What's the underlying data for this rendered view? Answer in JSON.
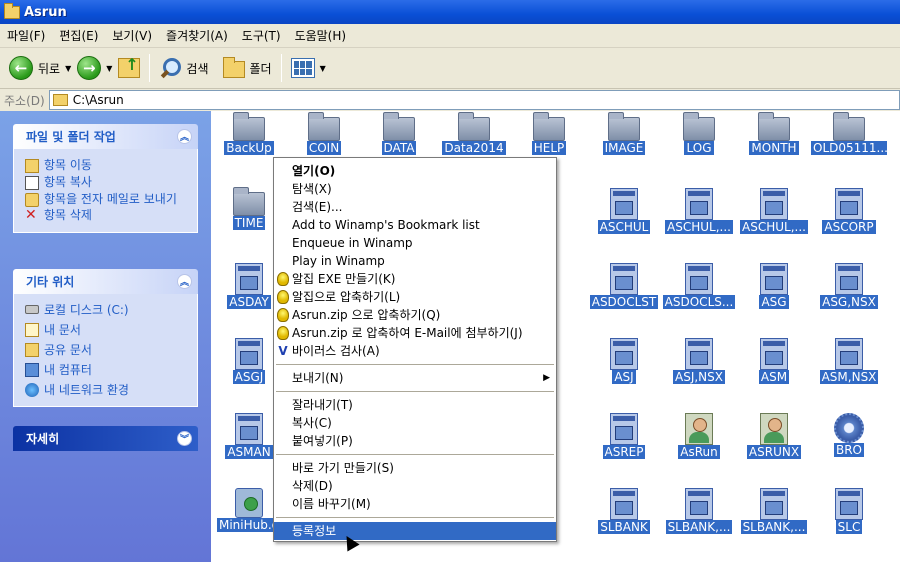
{
  "window": {
    "title": "Asrun"
  },
  "menubar": [
    "파일(F)",
    "편집(E)",
    "보기(V)",
    "즐겨찾기(A)",
    "도구(T)",
    "도움말(H)"
  ],
  "toolbar": {
    "back": "뒤로",
    "search": "검색",
    "folders": "폴더"
  },
  "address": {
    "label": "주소(D)",
    "path": "C:\\Asrun"
  },
  "taskpane": {
    "file_tasks": {
      "title": "파일 및 폴더 작업",
      "items": [
        "항목 이동",
        "항목 복사",
        "항목을 전자 메일로 보내기",
        "항목 삭제"
      ]
    },
    "other_places": {
      "title": "기타 위치",
      "items": [
        "로컬 디스크 (C:)",
        "내 문서",
        "공유 문서",
        "내 컴퓨터",
        "내 네트워크 환경"
      ]
    },
    "details": {
      "title": "자세히"
    }
  },
  "files": {
    "row1": [
      "BackUp",
      "COIN",
      "DATA",
      "Data2014",
      "HELP",
      "IMAGE",
      "LOG",
      "MONTH",
      "OLD05111..."
    ],
    "row2": [
      "TIME",
      "ASCHUL",
      "ASCHUL,...",
      "ASCHUL,...",
      "ASCORP"
    ],
    "row3": [
      "ASDAY",
      "ASDOCLST",
      "ASDOCLS...",
      "ASG",
      "ASG,NSX"
    ],
    "row4": [
      "ASGJ",
      "ASJ",
      "ASJ,NSX",
      "ASM",
      "ASM,NSX"
    ],
    "row5": [
      "ASMAN",
      "ASREP",
      "AsRun",
      "ASRUNX",
      "BRO"
    ],
    "row6": [
      "MiniHub.o",
      "SLBANK",
      "SLBANK,...",
      "SLBANK,...",
      "SLC"
    ]
  },
  "context_menu": [
    {
      "label": "열기(O)",
      "bold": true
    },
    {
      "label": "탐색(X)"
    },
    {
      "label": "검색(E)..."
    },
    {
      "label": "Add to Winamp's Bookmark list"
    },
    {
      "label": "Enqueue in Winamp"
    },
    {
      "label": "Play in Winamp"
    },
    {
      "label": "알집 EXE 만들기(K)",
      "icon": "bulb"
    },
    {
      "label": "알집으로 압축하기(L)",
      "icon": "bulb"
    },
    {
      "label": "Asrun.zip 으로 압축하기(Q)",
      "icon": "bulb"
    },
    {
      "label": "Asrun.zip 로 압축하여 E-Mail에 첨부하기(J)",
      "icon": "bulb"
    },
    {
      "label": "바이러스 검사(A)",
      "icon": "virus"
    },
    {
      "label": "보내기(N)",
      "submenu": true
    },
    {
      "label": "잘라내기(T)"
    },
    {
      "label": "복사(C)"
    },
    {
      "label": "붙여넣기(P)"
    },
    {
      "label": "바로 가기 만들기(S)"
    },
    {
      "label": "삭제(D)"
    },
    {
      "label": "이름 바꾸기(M)"
    },
    {
      "label": "등록정보",
      "highlighted": true
    }
  ]
}
